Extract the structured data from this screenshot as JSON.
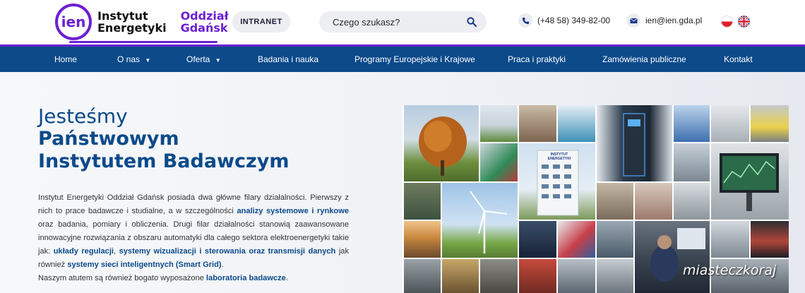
{
  "header": {
    "logo_mark": "ien",
    "logo_line1": "Instytut",
    "logo_line2": "Energetyki",
    "logo_branch1": "Oddział",
    "logo_branch2": "Gdańsk",
    "intranet_label": "INTRANET",
    "search_placeholder": "Czego szukasz?",
    "phone": "(+48 58) 349-82-00",
    "email": "ien@ien.gda.pl",
    "brand_color": "#6d1fd2"
  },
  "nav": {
    "home": "Home",
    "about": "O nas",
    "offer": "Oferta",
    "research": "Badania i nauka",
    "programs": "Programy Europejskie i Krajowe",
    "jobs": "Praca i praktyki",
    "procurement": "Zamówienia publiczne",
    "contact": "Kontakt",
    "bar_color": "#0c4a8a"
  },
  "hero": {
    "headline_light": "Jesteśmy",
    "headline_bold_1": "Państwowym",
    "headline_bold_2": "Instytutem Badawczym",
    "p1": "Instytut Energetyki Oddział Gdańsk posiada dwa główne filary działalności. Pierwszy z nich to prace badawcze i studialne, a w szczególności",
    "p1_link": "analizy systemowe i rynkowe",
    "p2": "oraz badania, pomiary i obliczenia. Drugi filar działalności stanowią zaawansowane innowacyjne rozwiązania z obszaru automatyki dla całego sektora elektroenergetyki takie jak:",
    "p2_link1": "układy regulacji",
    "p2_sep": ",",
    "p2_link2": "systemy wizualizacji i sterowania oraz transmisji danych",
    "p2_tail": "jak również",
    "p2_link3": "systemy sieci inteligentnych (Smart Grid)",
    "p2_end": ".",
    "p3": "Naszym atutem są również bogato wyposażone",
    "p3_link": "laboratoria badawcze",
    "p3_end": ".",
    "building_sign": "INSTYTUT ENERGETYKI",
    "watermark": "miasteczkoraj"
  }
}
